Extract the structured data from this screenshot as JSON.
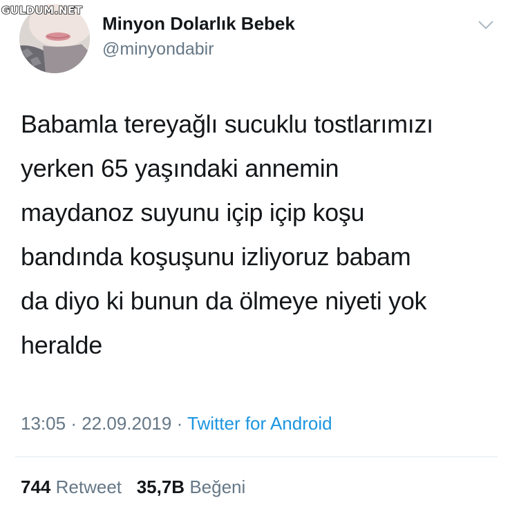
{
  "watermark": "GULDUM.NET",
  "profile": {
    "display_name": "Minyon Dolarlık Bebek",
    "handle": "@minyondabir"
  },
  "header": {
    "menu_icon": "chevron-down-icon"
  },
  "tweet": {
    "text": "Babamla tereyağlı sucuklu tostlarımızı\nyerken 65 yaşındaki annemin\nmaydanoz suyunu içip içip koşu\nbandında koşuşunu izliyoruz babam\nda diyo ki bunun da ölmeye niyeti yok\nheralde",
    "time": "13:05",
    "separator": "·",
    "date": "22.09.2019",
    "source": "Twitter for Android"
  },
  "stats": {
    "retweet_count": "744",
    "retweet_label": "Retweet",
    "like_count": "35,7B",
    "like_label": "Beğeni"
  },
  "colors": {
    "text": "#14171a",
    "secondary": "#657786",
    "link": "#1b95e0",
    "divider": "#e1e8ed"
  }
}
